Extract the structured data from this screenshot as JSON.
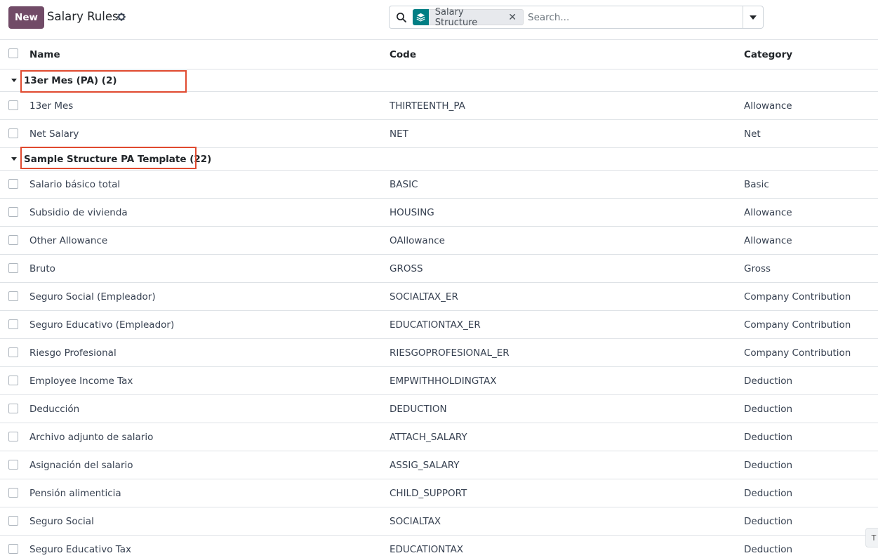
{
  "control_panel": {
    "new_button": "New",
    "title": "Salary Rules",
    "search": {
      "facet_label": "Salary Structure",
      "facet_remove": "✕",
      "placeholder": "Search..."
    }
  },
  "list": {
    "columns": {
      "name": "Name",
      "code": "Code",
      "category": "Category"
    },
    "groups": [
      {
        "label": "13er Mes (PA) (2)",
        "rows": [
          {
            "name": "13er Mes",
            "code": "THIRTEENTH_PA",
            "category": "Allowance"
          },
          {
            "name": "Net Salary",
            "code": "NET",
            "category": "Net"
          }
        ]
      },
      {
        "label": "Sample Structure PA Template (22)",
        "rows": [
          {
            "name": "Salario básico total",
            "code": "BASIC",
            "category": "Basic"
          },
          {
            "name": "Subsidio de vivienda",
            "code": "HOUSING",
            "category": "Allowance"
          },
          {
            "name": "Other Allowance",
            "code": "OAllowance",
            "category": "Allowance"
          },
          {
            "name": "Bruto",
            "code": "GROSS",
            "category": "Gross"
          },
          {
            "name": "Seguro Social (Empleador)",
            "code": "SOCIALTAX_ER",
            "category": "Company Contribution"
          },
          {
            "name": "Seguro Educativo (Empleador)",
            "code": "EDUCATIONTAX_ER",
            "category": "Company Contribution"
          },
          {
            "name": "Riesgo Profesional",
            "code": "RIESGOPROFESIONAL_ER",
            "category": "Company Contribution"
          },
          {
            "name": "Employee Income Tax",
            "code": "EMPWITHHOLDINGTAX",
            "category": "Deduction"
          },
          {
            "name": "Deducción",
            "code": "DEDUCTION",
            "category": "Deduction"
          },
          {
            "name": "Archivo adjunto de salario",
            "code": "ATTACH_SALARY",
            "category": "Deduction"
          },
          {
            "name": "Asignación del salario",
            "code": "ASSIG_SALARY",
            "category": "Deduction"
          },
          {
            "name": "Pensión alimenticia",
            "code": "CHILD_SUPPORT",
            "category": "Deduction"
          },
          {
            "name": "Seguro Social",
            "code": "SOCIALTAX",
            "category": "Deduction"
          },
          {
            "name": "Seguro Educativo Tax",
            "code": "EDUCATIONTAX",
            "category": "Deduction"
          }
        ]
      }
    ]
  },
  "colors": {
    "primary": "#714b67",
    "facet_accent": "#017e84",
    "annotation": "#e04a2f"
  },
  "corner_button": "T"
}
